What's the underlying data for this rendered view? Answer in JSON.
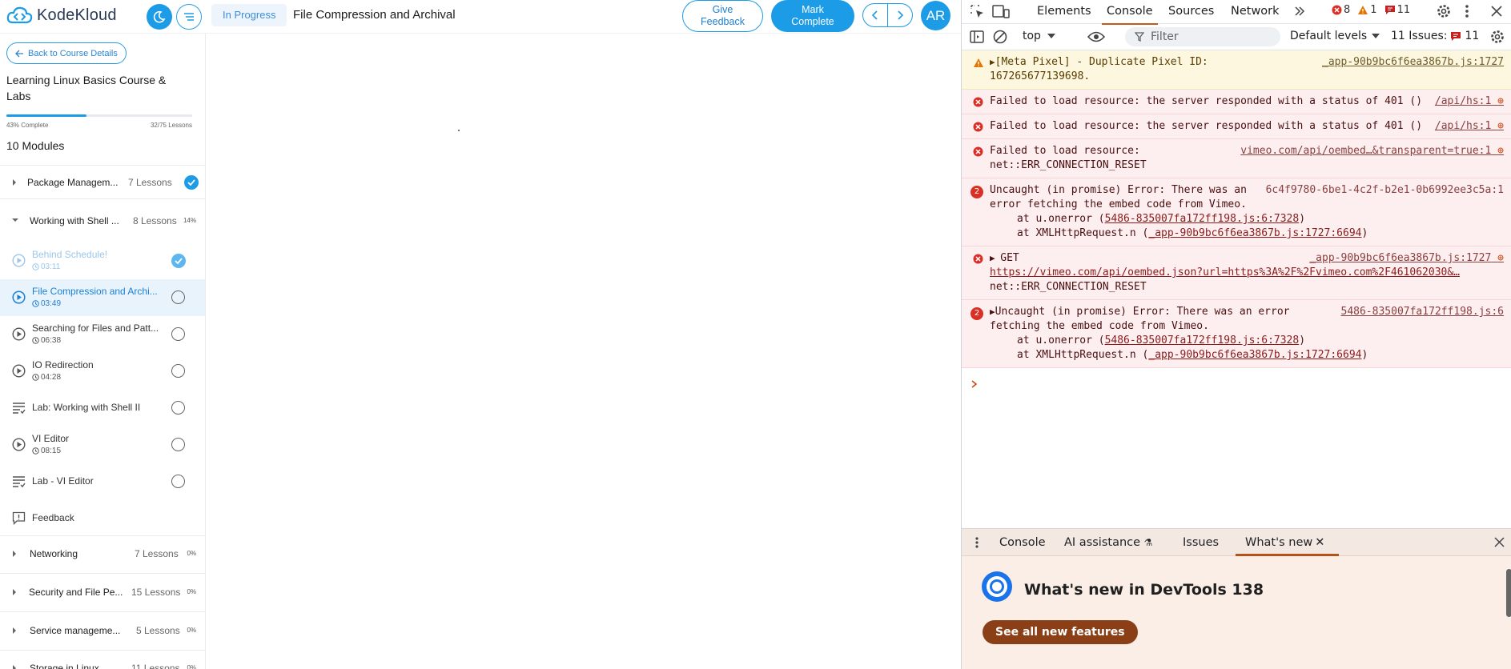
{
  "app": {
    "logo_text": "KodeKloud",
    "status": "In Progress",
    "lesson_title": "File Compression and Archival",
    "give_feedback_label": "Give Feedback",
    "mark_complete_label": "Mark Complete",
    "avatar_initials": "AR"
  },
  "sidebar": {
    "back_label": "Back to Course Details",
    "course_title": "Learning Linux Basics Course & Labs",
    "progress_fraction": 0.43,
    "progress_complete_text": "43% Complete",
    "progress_lessons_text": "32/75 Lessons",
    "modules_count": "10 Modules",
    "modules": [
      {
        "name": "Package Managem...",
        "count": "7 Lessons",
        "pct": "",
        "expanded": false,
        "completed": true
      },
      {
        "name": "Working with Shell ...",
        "count": "8 Lessons",
        "pct": "14%",
        "expanded": true,
        "completed": false
      },
      {
        "name": "Networking",
        "count": "7 Lessons",
        "pct": "0%",
        "expanded": false,
        "completed": false
      },
      {
        "name": "Security and File Pe...",
        "count": "15 Lessons",
        "pct": "0%",
        "expanded": false,
        "completed": false
      },
      {
        "name": "Service manageme...",
        "count": "5 Lessons",
        "pct": "0%",
        "expanded": false,
        "completed": false
      },
      {
        "name": "Storage in Linux",
        "count": "11 Lessons",
        "pct": "0%",
        "expanded": false,
        "completed": false
      }
    ],
    "lessons": [
      {
        "name": "Behind Schedule!",
        "duration": "03:11",
        "type": "video",
        "state": "completed"
      },
      {
        "name": "File Compression and Archi...",
        "duration": "03:49",
        "type": "video",
        "state": "active"
      },
      {
        "name": "Searching for Files and Patt...",
        "duration": "06:38",
        "type": "video",
        "state": "pending"
      },
      {
        "name": "IO Redirection",
        "duration": "04:28",
        "type": "video",
        "state": "pending"
      },
      {
        "name": "Lab: Working with Shell II",
        "duration": "",
        "type": "lab",
        "state": "pending"
      },
      {
        "name": "VI Editor",
        "duration": "08:15",
        "type": "video",
        "state": "pending"
      },
      {
        "name": "Lab - VI Editor",
        "duration": "",
        "type": "lab",
        "state": "pending"
      },
      {
        "name": "Feedback",
        "duration": "",
        "type": "feedback",
        "state": "none"
      }
    ]
  },
  "devtools": {
    "tabs": [
      "Elements",
      "Console",
      "Sources",
      "Network"
    ],
    "active_tab": "Console",
    "error_count": "8",
    "warning_count": "1",
    "issues_count": "11",
    "context": "top",
    "filter_placeholder": "Filter",
    "levels": "Default levels",
    "issues_label": "11 Issues:",
    "issues_badge": "11",
    "messages": {
      "m1_text": "[Meta Pixel] - Duplicate Pixel ID: 167265677139698.",
      "m1_src": "_app-90b9bc6f6ea3867b.js:1727",
      "m2_text": "Failed to load resource: the server responded with a status of 401 ()",
      "m2_src": "/api/hs:1",
      "m3_text": "Failed to load resource: the server responded with a status of 401 ()",
      "m3_src": "/api/hs:1",
      "m4_text": "Failed to load resource: net::ERR_CONNECTION_RESET",
      "m4_src": "vimeo.com/api/oembed…&transparent=true:1",
      "m5_count": "2",
      "m5_text": "Uncaught (in promise) Error: There was an error fetching the embed code from Vimeo.",
      "m5_src": "6c4f9780-6be1-4c2f-b2e1-0b6992ee3c5a:1",
      "m5_at1_prefix": "at u.onerror (",
      "m5_at1_link": "5486-835007fa172ff198.js:6:7328",
      "m5_at2_prefix": "at XMLHttpRequest.n (",
      "m5_at2_link": "_app-90b9bc6f6ea3867b.js:1727:6694",
      "m6_method": "GET",
      "m6_src": "_app-90b9bc6f6ea3867b.js:1727",
      "m6_url": "https://vimeo.com/api/oembed.json?url=https%3A%2F%2Fvimeo.com%2F461062030&…",
      "m6_err": "net::ERR_CONNECTION_RESET",
      "m7_count": "2",
      "m7_text": "Uncaught (in promise) Error: There was an error fetching the embed code from Vimeo.",
      "m7_src": "5486-835007fa172ff198.js:6",
      "m7_at1_prefix": "at u.onerror (",
      "m7_at1_link": "5486-835007fa172ff198.js:6:7328",
      "m7_at2_prefix": "at XMLHttpRequest.n (",
      "m7_at2_link": "_app-90b9bc6f6ea3867b.js:1727:6694"
    },
    "drawer_tabs": [
      "Console",
      "AI assistance",
      "Issues",
      "What's new"
    ],
    "whats_new_title": "What's new in DevTools 138",
    "whats_new_button": "See all new features"
  },
  "colors": {
    "brand": "#1c9be6",
    "devtools_accent": "#c15a1a",
    "error_bg": "#fdeeef",
    "warning_bg": "#fdf7df"
  }
}
